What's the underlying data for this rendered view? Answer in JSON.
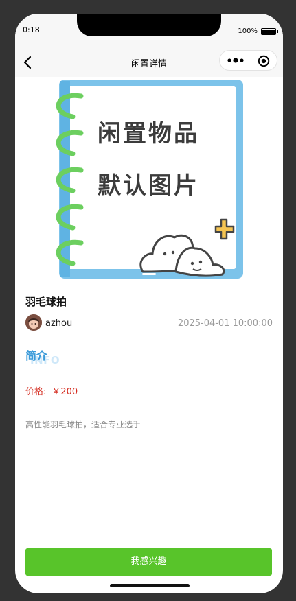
{
  "status_bar": {
    "time": "0:18",
    "battery": "100%"
  },
  "nav": {
    "title": "闲置详情"
  },
  "hero": {
    "text_line1": "闲置物品",
    "text_line2": "默认图片"
  },
  "item": {
    "title": "羽毛球拍",
    "username": "azhou",
    "date": "2025-04-01 10:00:00",
    "section_cn": "简介",
    "section_en": "INFO",
    "price_label": "价格:",
    "price_value": "￥200",
    "description": "高性能羽毛球拍，适合专业选手"
  },
  "cta": {
    "label": "我感兴趣"
  },
  "colors": {
    "accent_blue": "#3a9ad9",
    "price_red": "#d42a1e",
    "button_green": "#58c42a"
  }
}
